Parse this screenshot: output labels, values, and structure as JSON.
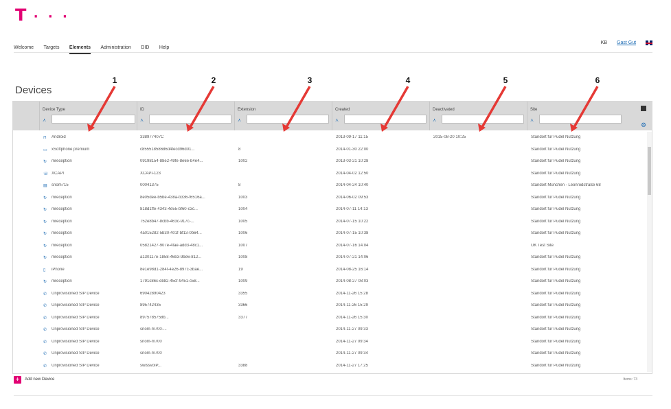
{
  "brand": {
    "logo_t": "T",
    "logo_dots": "· · ·"
  },
  "nav": {
    "tabs": [
      "Welcome",
      "Targets",
      "Elements",
      "Administration",
      "DID",
      "Help"
    ],
    "active": "Elements",
    "kb_label": "KB",
    "user_label": "Gast Gut"
  },
  "page_title": "Devices",
  "columns": [
    {
      "label": "Device Type",
      "marker": "1"
    },
    {
      "label": "ID",
      "marker": "2"
    },
    {
      "label": "Extension",
      "marker": "3"
    },
    {
      "label": "Created",
      "marker": "4"
    },
    {
      "label": "Deactivated",
      "marker": "5"
    },
    {
      "label": "Site",
      "marker": "6"
    }
  ],
  "rows": [
    {
      "icon": "android-icon",
      "type": "Android",
      "id": "338977407C",
      "ext": "",
      "created": "2013-09-17 11:15",
      "deact": "2015-08-20 10:25",
      "site": "Standort für Pudel Nutzung"
    },
    {
      "icon": "softphone-icon",
      "type": "xSoftphone premium",
      "id": "c85551858686d4fecd96d01...",
      "ext": "8",
      "created": "2014-01-30 22:00",
      "deact": "",
      "site": "Standort für Pudel Nutzung"
    },
    {
      "icon": "sync-icon",
      "type": "mreception",
      "id": "09198154-88e2-49fe-8e6e-b4e4...",
      "ext": "1002",
      "created": "2013-03-21 10:28",
      "deact": "",
      "site": "Standort für Pudel Nutzung"
    },
    {
      "icon": "phone-icon",
      "type": "XCAPI",
      "id": "XCAPI-123",
      "ext": "",
      "created": "2014-04-02 12:50",
      "deact": "",
      "site": "Standort für Pudel Nutzung"
    },
    {
      "icon": "deskphone-icon",
      "type": "snom715",
      "id": "00041375",
      "ext": "8",
      "created": "2014-04-24 10:40",
      "deact": "",
      "site": "Standort München - Leonrodstraße 68"
    },
    {
      "icon": "sync-icon",
      "type": "mreception",
      "id": "8e05dee-b5be-438a-b336-f6516a...",
      "ext": "1003",
      "created": "2014-06-02 09:53",
      "deact": "",
      "site": "Standort für Pudel Nutzung"
    },
    {
      "icon": "sync-icon",
      "type": "mreception",
      "id": "818d1ffe-4343-4e55-bf60-c3c...",
      "ext": "1004",
      "created": "2014-07-11 14:13",
      "deact": "",
      "site": "Standort für Pudel Nutzung"
    },
    {
      "icon": "sync-icon",
      "type": "mreception",
      "id": "752e8b47-8cbb-463c-917c-...",
      "ext": "1005",
      "created": "2014-07-15 10:22",
      "deact": "",
      "site": "Standort für Pudel Nutzung"
    },
    {
      "icon": "sync-icon",
      "type": "mreception",
      "id": "4a015282-5b30-401f-bf13-0b64...",
      "ext": "1006",
      "created": "2014-07-15 10:38",
      "deact": "",
      "site": "Standort für Pudel Nutzung"
    },
    {
      "icon": "sync-icon",
      "type": "mreception",
      "id": "05821427-907e-4fae-add3-48c1...",
      "ext": "1007",
      "created": "2014-07-16 14:04",
      "deact": "",
      "site": "UK Test Site"
    },
    {
      "icon": "sync-icon",
      "type": "mreception",
      "id": "a130117e-1858-46b3-9be6-812...",
      "ext": "1008",
      "created": "2014-07-21 14:06",
      "deact": "",
      "site": "Standort für Pudel Nutzung"
    },
    {
      "icon": "iphone-icon",
      "type": "iPhone",
      "id": "8e1e98d1-284f-4e26-897c-3bae...",
      "ext": "19",
      "created": "2014-08-25 16:14",
      "deact": "",
      "site": "Standort für Pudel Nutzung"
    },
    {
      "icon": "sync-icon",
      "type": "mreception",
      "id": "1791c86c-eb82-45cf-9451-c58...",
      "ext": "1009",
      "created": "2014-08-27 08:03",
      "deact": "",
      "site": "Standort für Pudel Nutzung"
    },
    {
      "icon": "sip-icon",
      "type": "Unprovisioned SIP Device",
      "id": "69042890423",
      "ext": "3355",
      "created": "2014-11-26 15:28",
      "deact": "",
      "site": "Standort für Pudel Nutzung"
    },
    {
      "icon": "sip-icon",
      "type": "Unprovisioned SIP Device",
      "id": "895742435",
      "ext": "3366",
      "created": "2014-11-26 15:29",
      "deact": "",
      "site": "Standort für Pudel Nutzung"
    },
    {
      "icon": "sip-icon",
      "type": "Unprovisioned SIP Device",
      "id": "8975785758b...",
      "ext": "3377",
      "created": "2014-11-26 15:30",
      "deact": "",
      "site": "Standort für Pudel Nutzung"
    },
    {
      "icon": "sip-icon",
      "type": "Unprovisioned SIP Device",
      "id": "snom-m700-...",
      "ext": "",
      "created": "2014-11-27 09:33",
      "deact": "",
      "site": "Standort für Pudel Nutzung"
    },
    {
      "icon": "sip-icon",
      "type": "Unprovisioned SIP Device",
      "id": "snom-m700",
      "ext": "",
      "created": "2014-11-27 09:34",
      "deact": "",
      "site": "Standort für Pudel Nutzung"
    },
    {
      "icon": "sip-icon",
      "type": "Unprovisioned SIP Device",
      "id": "snom-m700",
      "ext": "",
      "created": "2014-11-27 09:34",
      "deact": "",
      "site": "Standort für Pudel Nutzung"
    },
    {
      "icon": "sip-icon",
      "type": "Unprovisioned SIP Device",
      "id": "swissvoIP...",
      "ext": "3388",
      "created": "2014-11-27 17:25",
      "deact": "",
      "site": "Standort für Pudel Nutzung"
    }
  ],
  "footer": {
    "add_label": "Add new Device",
    "items_label": "Items: 73"
  },
  "colors": {
    "brand": "#e20074",
    "link": "#1a6ab3",
    "marker": "#e53935"
  }
}
